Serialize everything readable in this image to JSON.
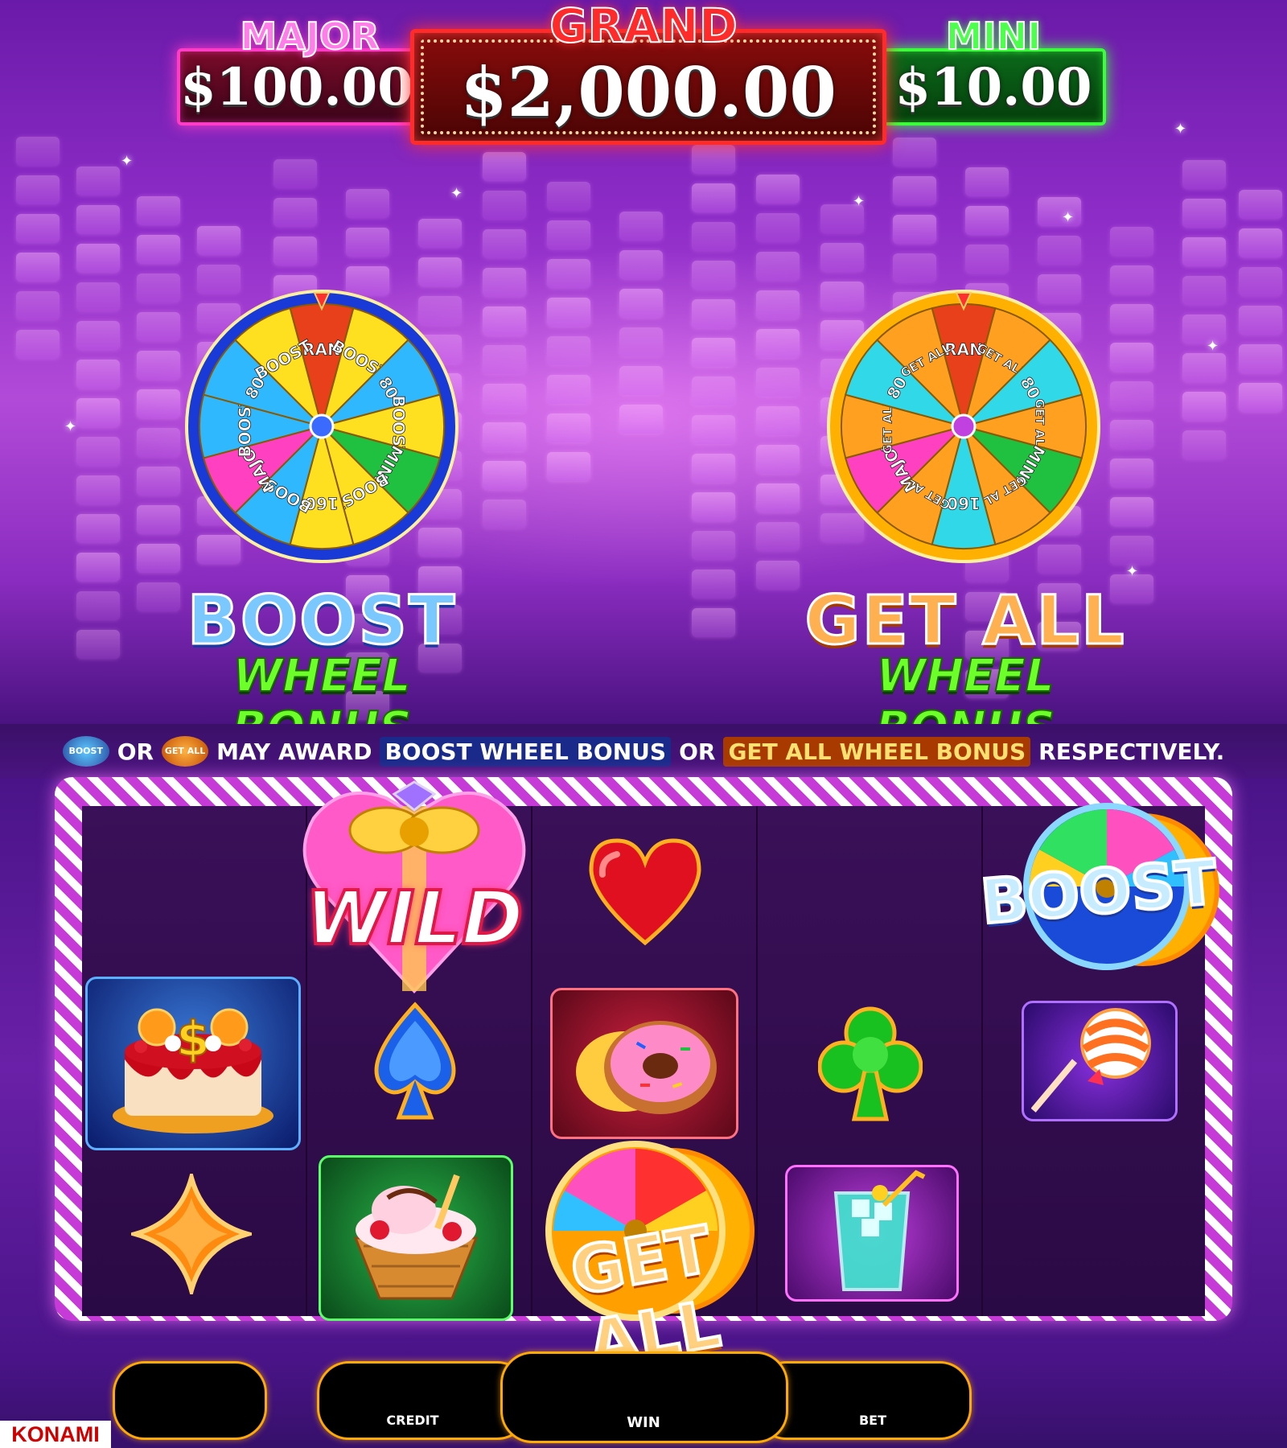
{
  "jackpots": {
    "major": {
      "label": "MAJOR",
      "value": "$100.00"
    },
    "grand": {
      "label": "GRAND",
      "value": "$2,000.00"
    },
    "mini": {
      "label": "MINI",
      "value": "$10.00"
    }
  },
  "wheels": {
    "boost": {
      "title": "BOOST",
      "subtitle": "WHEEL BONUS",
      "segments": [
        "GRAND",
        "BOOST",
        "80",
        "BOOST",
        "MINI",
        "BOOST",
        "160",
        "BOOST",
        "MAJOR",
        "BOOST",
        "80",
        "BOOST"
      ]
    },
    "getall": {
      "title": "GET ALL",
      "subtitle": "WHEEL BONUS",
      "segments": [
        "GRAND",
        "GET ALL",
        "80",
        "GET ALL",
        "MINI",
        "GET ALL",
        "160",
        "GET ALL",
        "MAJOR",
        "GET ALL",
        "80",
        "GET ALL"
      ]
    }
  },
  "info": {
    "badge_boost": "BOOST",
    "or_1": "OR",
    "badge_getall": "GET ALL",
    "may_award": "MAY AWARD",
    "boost_bonus": "BOOST WHEEL BONUS",
    "or_2": "OR",
    "getall_bonus": "GET ALL WHEEL BONUS",
    "respectively": "RESPECTIVELY."
  },
  "reels": {
    "wild_label": "WILD",
    "boost_label": "BOOST",
    "getall_label": "GET ALL",
    "symbols": [
      [
        "blank",
        "cake",
        "diamond"
      ],
      [
        "wild",
        "spade",
        "sundae"
      ],
      [
        "heart",
        "donut",
        "getall"
      ],
      [
        "blank",
        "club",
        "drink"
      ],
      [
        "boost",
        "lollipop",
        "blank"
      ]
    ]
  },
  "meters": {
    "credit_label": "CREDIT",
    "win_label": "WIN",
    "bet_label": "BET"
  },
  "brand": {
    "name": "KONAMI"
  },
  "colors": {
    "major": "#ff3cc8",
    "grand": "#ff2a2a",
    "mini": "#3cff3c",
    "frame_stripe": "#c63ad8",
    "meter_border": "#ffaa00"
  }
}
